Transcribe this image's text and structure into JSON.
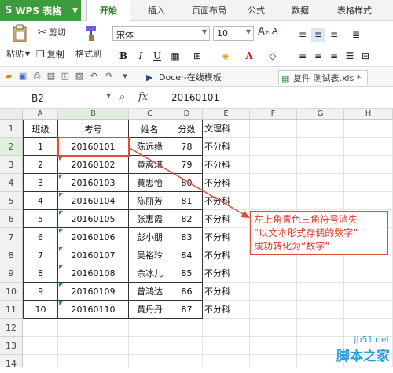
{
  "menubar": {
    "app_label": "WPS 表格",
    "tabs": [
      "开始",
      "插入",
      "页面布局",
      "公式",
      "数据",
      "表格样式"
    ]
  },
  "ribbon": {
    "paste_label": "粘贴",
    "cut_label": "剪切",
    "copy_label": "复制",
    "format_painter_label": "格式刷",
    "font_name": "宋体",
    "font_size": "10"
  },
  "quickbar": {
    "tab_docer": "Docer-在线模板",
    "tab_file": "复件 测试表.xls *"
  },
  "formula": {
    "cell_ref": "B2",
    "fx_label": "fx",
    "value": "20160101"
  },
  "columns": [
    "A",
    "B",
    "C",
    "D",
    "E",
    "F",
    "G",
    "H"
  ],
  "rows": [
    "1",
    "2",
    "3",
    "4",
    "5",
    "6",
    "7",
    "8",
    "9",
    "10",
    "11",
    "12",
    "13",
    "14"
  ],
  "table": {
    "headers": [
      "班级",
      "考号",
      "姓名",
      "分数",
      "文理科"
    ],
    "data": [
      [
        "1",
        "20160101",
        "陈远缘",
        "78",
        "不分科"
      ],
      [
        "2",
        "20160102",
        "黄嵩琪",
        "79",
        "不分科"
      ],
      [
        "3",
        "20160103",
        "黄思怡",
        "80",
        "不分科"
      ],
      [
        "4",
        "20160104",
        "陈丽芳",
        "81",
        "不分科"
      ],
      [
        "5",
        "20160105",
        "张惠霞",
        "82",
        "不分科"
      ],
      [
        "6",
        "20160106",
        "彭小朋",
        "83",
        "不分科"
      ],
      [
        "7",
        "20160107",
        "吴裕玲",
        "84",
        "不分科"
      ],
      [
        "8",
        "20160108",
        "余冰儿",
        "85",
        "不分科"
      ],
      [
        "9",
        "20160109",
        "曾鸿达",
        "86",
        "不分科"
      ],
      [
        "10",
        "20160110",
        "黄丹丹",
        "87",
        "不分科"
      ]
    ]
  },
  "callout": {
    "line1": "左上角青色三角符号消失",
    "line2": "“以文本形式存储的数字”",
    "line3": "成功转化为“数字”"
  },
  "watermark": {
    "url": "jb51.net",
    "name": "脚本之家"
  },
  "colors": {
    "wps_green": "#3d9c3d",
    "annotation_red": "#e04b3a",
    "error_triangle": "#1a9a4a"
  }
}
